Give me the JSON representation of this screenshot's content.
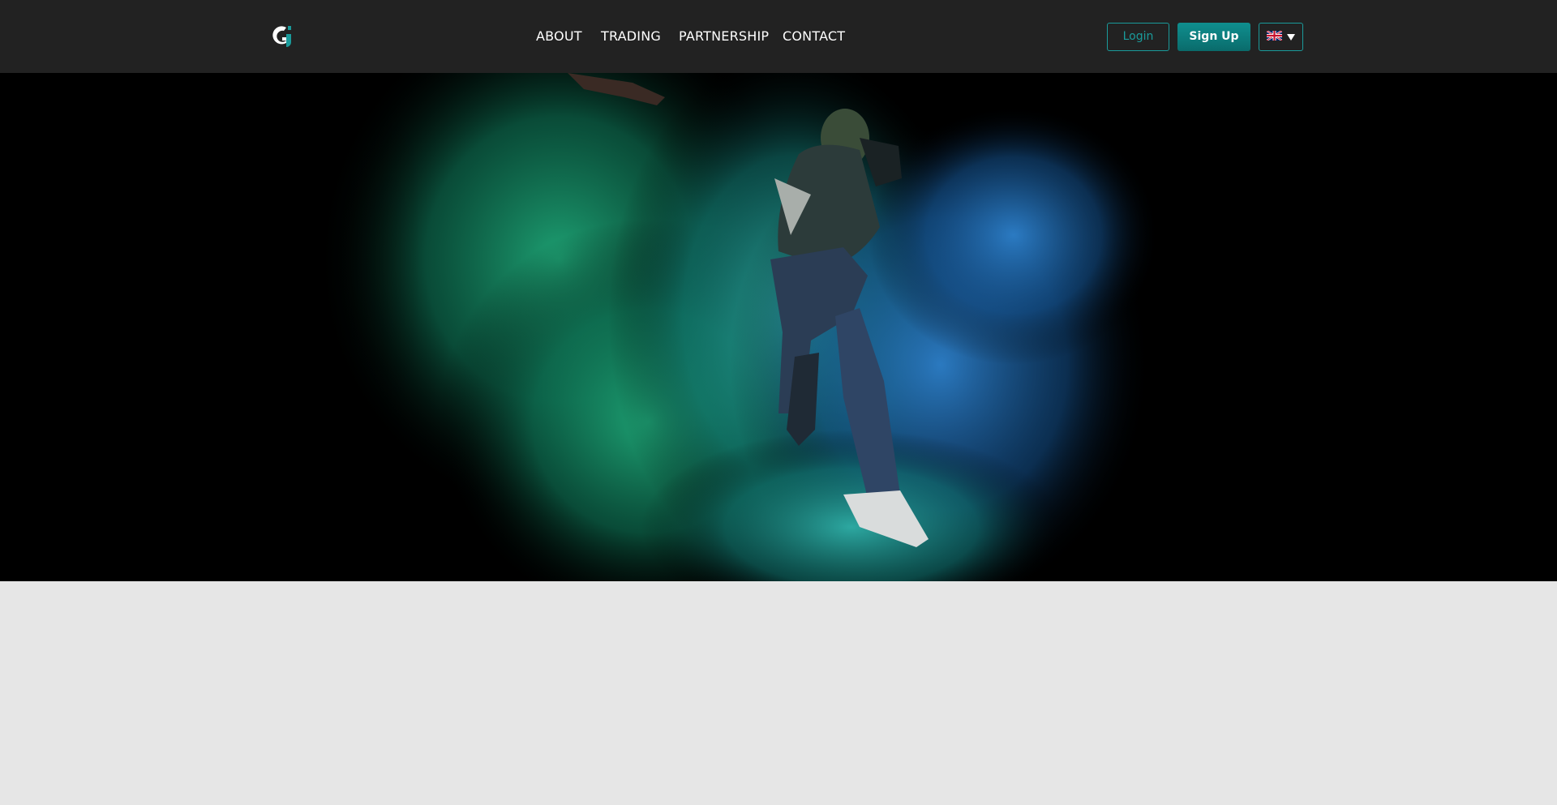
{
  "header": {
    "logo_icon": "brand-g-logo-icon",
    "nav": {
      "about": "ABOUT",
      "trading": "TRADING",
      "partnership": "PARTNERSHIP",
      "contact": "CONTACT"
    },
    "login_label": "Login",
    "signup_label": "Sign Up",
    "language": {
      "icon": "uk-flag-icon",
      "dropdown_icon": "caret-down-icon"
    }
  },
  "hero": {
    "image": "dancer-jumping-in-green-blue-powder-explosion"
  },
  "colors": {
    "header_bg": "#222222",
    "accent": "#1a9b9b",
    "signup_bg": "#0f8f8f",
    "page_bg": "#e6e6e6",
    "hero_bg": "#000000"
  }
}
